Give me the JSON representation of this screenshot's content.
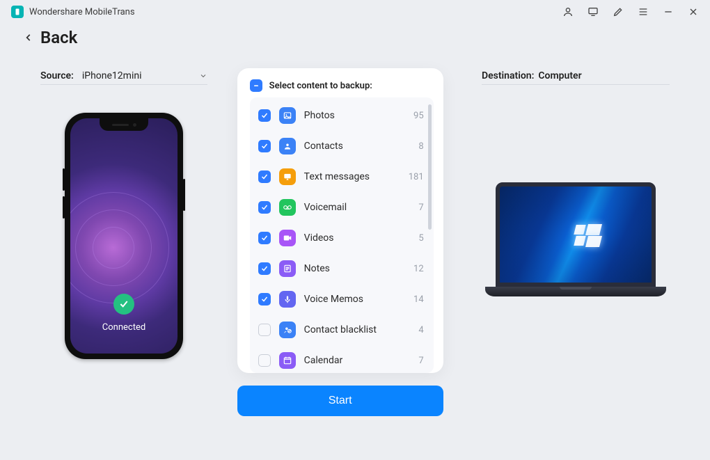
{
  "app": {
    "title": "Wondershare MobileTrans"
  },
  "nav": {
    "back_label": "Back"
  },
  "source": {
    "prefix": "Source:",
    "device": "iPhone12mini",
    "status": "Connected"
  },
  "destination": {
    "prefix": "Destination:",
    "device": "Computer"
  },
  "mid": {
    "header": "Select content to backup:"
  },
  "items": [
    {
      "label": "Photos",
      "count": "95",
      "checked": true,
      "icon": "photos",
      "color": "#3b82f6"
    },
    {
      "label": "Contacts",
      "count": "8",
      "checked": true,
      "icon": "contacts",
      "color": "#3b82f6"
    },
    {
      "label": "Text messages",
      "count": "181",
      "checked": true,
      "icon": "messages",
      "color": "#f59e0b"
    },
    {
      "label": "Voicemail",
      "count": "7",
      "checked": true,
      "icon": "voicemail",
      "color": "#22c55e"
    },
    {
      "label": "Videos",
      "count": "5",
      "checked": true,
      "icon": "videos",
      "color": "#a855f7"
    },
    {
      "label": "Notes",
      "count": "12",
      "checked": true,
      "icon": "notes",
      "color": "#8b5cf6"
    },
    {
      "label": "Voice Memos",
      "count": "14",
      "checked": true,
      "icon": "voicememo",
      "color": "#6366f1"
    },
    {
      "label": "Contact blacklist",
      "count": "4",
      "checked": false,
      "icon": "blacklist",
      "color": "#3b82f6"
    },
    {
      "label": "Calendar",
      "count": "7",
      "checked": false,
      "icon": "calendar",
      "color": "#8b5cf6"
    }
  ],
  "actions": {
    "start": "Start"
  }
}
